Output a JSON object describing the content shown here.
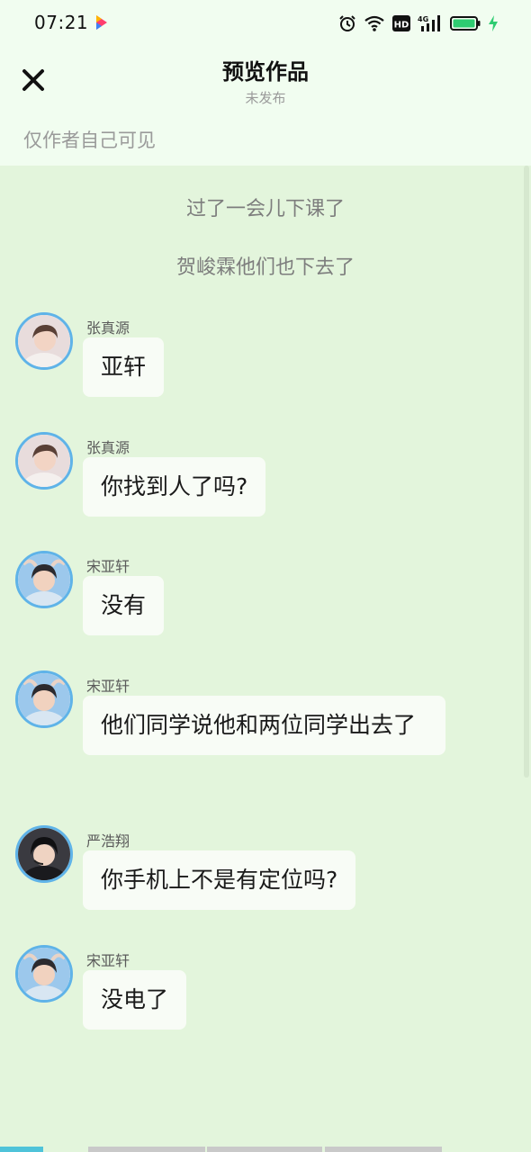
{
  "status_bar": {
    "time": "07:21",
    "icons": [
      "app-badge-icon",
      "alarm-icon",
      "wifi-icon",
      "hd-icon",
      "signal-4g-icon",
      "battery-icon",
      "charging-icon"
    ],
    "hd_label": "HD",
    "network_label": "4G",
    "battery_color": "#2ecc71"
  },
  "header": {
    "title": "预览作品",
    "subtitle": "未发布",
    "visibility_note": "仅作者自己可见",
    "close_icon": "close-icon"
  },
  "chat": {
    "narrations": [
      "过了一会儿下课了",
      "贺峻霖他们也下去了"
    ],
    "messages": [
      {
        "sender": "张真源",
        "text": "亚轩"
      },
      {
        "sender": "张真源",
        "text": "你找到人了吗?"
      },
      {
        "sender": "宋亚轩",
        "text": "没有"
      },
      {
        "sender": "宋亚轩",
        "text": "他们同学说他和两位同学出去了"
      },
      {
        "sender": "严浩翔",
        "text": "你手机上不是有定位吗?"
      },
      {
        "sender": "宋亚轩",
        "text": "没电了"
      }
    ]
  },
  "colors": {
    "background": "#e3f5dc",
    "header_background": "#f1fdf0",
    "bubble": "#f8fcf6",
    "avatar_ring": "#5fb3e8",
    "active_tab": "#4fc3d9"
  }
}
